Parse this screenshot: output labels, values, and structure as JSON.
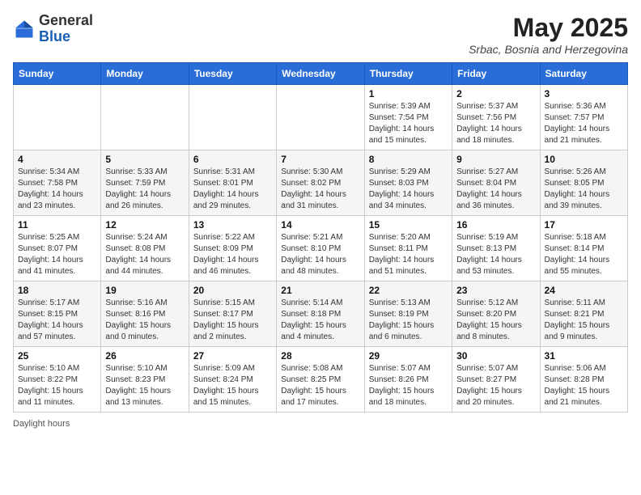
{
  "logo": {
    "general": "General",
    "blue": "Blue"
  },
  "title": {
    "month_year": "May 2025",
    "location": "Srbac, Bosnia and Herzegovina"
  },
  "days_of_week": [
    "Sunday",
    "Monday",
    "Tuesday",
    "Wednesday",
    "Thursday",
    "Friday",
    "Saturday"
  ],
  "footer": {
    "label": "Daylight hours"
  },
  "weeks": [
    [
      {
        "date": "",
        "info": ""
      },
      {
        "date": "",
        "info": ""
      },
      {
        "date": "",
        "info": ""
      },
      {
        "date": "",
        "info": ""
      },
      {
        "date": "1",
        "info": "Sunrise: 5:39 AM\nSunset: 7:54 PM\nDaylight: 14 hours\nand 15 minutes."
      },
      {
        "date": "2",
        "info": "Sunrise: 5:37 AM\nSunset: 7:56 PM\nDaylight: 14 hours\nand 18 minutes."
      },
      {
        "date": "3",
        "info": "Sunrise: 5:36 AM\nSunset: 7:57 PM\nDaylight: 14 hours\nand 21 minutes."
      }
    ],
    [
      {
        "date": "4",
        "info": "Sunrise: 5:34 AM\nSunset: 7:58 PM\nDaylight: 14 hours\nand 23 minutes."
      },
      {
        "date": "5",
        "info": "Sunrise: 5:33 AM\nSunset: 7:59 PM\nDaylight: 14 hours\nand 26 minutes."
      },
      {
        "date": "6",
        "info": "Sunrise: 5:31 AM\nSunset: 8:01 PM\nDaylight: 14 hours\nand 29 minutes."
      },
      {
        "date": "7",
        "info": "Sunrise: 5:30 AM\nSunset: 8:02 PM\nDaylight: 14 hours\nand 31 minutes."
      },
      {
        "date": "8",
        "info": "Sunrise: 5:29 AM\nSunset: 8:03 PM\nDaylight: 14 hours\nand 34 minutes."
      },
      {
        "date": "9",
        "info": "Sunrise: 5:27 AM\nSunset: 8:04 PM\nDaylight: 14 hours\nand 36 minutes."
      },
      {
        "date": "10",
        "info": "Sunrise: 5:26 AM\nSunset: 8:05 PM\nDaylight: 14 hours\nand 39 minutes."
      }
    ],
    [
      {
        "date": "11",
        "info": "Sunrise: 5:25 AM\nSunset: 8:07 PM\nDaylight: 14 hours\nand 41 minutes."
      },
      {
        "date": "12",
        "info": "Sunrise: 5:24 AM\nSunset: 8:08 PM\nDaylight: 14 hours\nand 44 minutes."
      },
      {
        "date": "13",
        "info": "Sunrise: 5:22 AM\nSunset: 8:09 PM\nDaylight: 14 hours\nand 46 minutes."
      },
      {
        "date": "14",
        "info": "Sunrise: 5:21 AM\nSunset: 8:10 PM\nDaylight: 14 hours\nand 48 minutes."
      },
      {
        "date": "15",
        "info": "Sunrise: 5:20 AM\nSunset: 8:11 PM\nDaylight: 14 hours\nand 51 minutes."
      },
      {
        "date": "16",
        "info": "Sunrise: 5:19 AM\nSunset: 8:13 PM\nDaylight: 14 hours\nand 53 minutes."
      },
      {
        "date": "17",
        "info": "Sunrise: 5:18 AM\nSunset: 8:14 PM\nDaylight: 14 hours\nand 55 minutes."
      }
    ],
    [
      {
        "date": "18",
        "info": "Sunrise: 5:17 AM\nSunset: 8:15 PM\nDaylight: 14 hours\nand 57 minutes."
      },
      {
        "date": "19",
        "info": "Sunrise: 5:16 AM\nSunset: 8:16 PM\nDaylight: 15 hours\nand 0 minutes."
      },
      {
        "date": "20",
        "info": "Sunrise: 5:15 AM\nSunset: 8:17 PM\nDaylight: 15 hours\nand 2 minutes."
      },
      {
        "date": "21",
        "info": "Sunrise: 5:14 AM\nSunset: 8:18 PM\nDaylight: 15 hours\nand 4 minutes."
      },
      {
        "date": "22",
        "info": "Sunrise: 5:13 AM\nSunset: 8:19 PM\nDaylight: 15 hours\nand 6 minutes."
      },
      {
        "date": "23",
        "info": "Sunrise: 5:12 AM\nSunset: 8:20 PM\nDaylight: 15 hours\nand 8 minutes."
      },
      {
        "date": "24",
        "info": "Sunrise: 5:11 AM\nSunset: 8:21 PM\nDaylight: 15 hours\nand 9 minutes."
      }
    ],
    [
      {
        "date": "25",
        "info": "Sunrise: 5:10 AM\nSunset: 8:22 PM\nDaylight: 15 hours\nand 11 minutes."
      },
      {
        "date": "26",
        "info": "Sunrise: 5:10 AM\nSunset: 8:23 PM\nDaylight: 15 hours\nand 13 minutes."
      },
      {
        "date": "27",
        "info": "Sunrise: 5:09 AM\nSunset: 8:24 PM\nDaylight: 15 hours\nand 15 minutes."
      },
      {
        "date": "28",
        "info": "Sunrise: 5:08 AM\nSunset: 8:25 PM\nDaylight: 15 hours\nand 17 minutes."
      },
      {
        "date": "29",
        "info": "Sunrise: 5:07 AM\nSunset: 8:26 PM\nDaylight: 15 hours\nand 18 minutes."
      },
      {
        "date": "30",
        "info": "Sunrise: 5:07 AM\nSunset: 8:27 PM\nDaylight: 15 hours\nand 20 minutes."
      },
      {
        "date": "31",
        "info": "Sunrise: 5:06 AM\nSunset: 8:28 PM\nDaylight: 15 hours\nand 21 minutes."
      }
    ]
  ]
}
